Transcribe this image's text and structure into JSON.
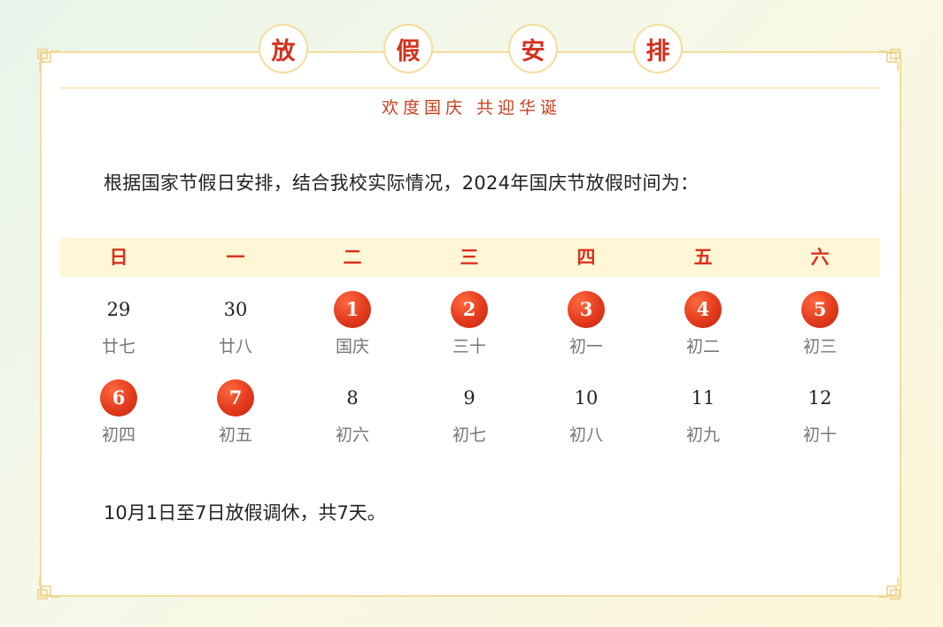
{
  "title_chars": [
    "放",
    "假",
    "安",
    "排"
  ],
  "subtitle": "欢度国庆  共迎华诞",
  "intro": "根据国家节假日安排，结合我校实际情况，2024年国庆节放假时间为：",
  "weekdays": [
    "日",
    "一",
    "二",
    "三",
    "四",
    "五",
    "六"
  ],
  "weeks": [
    [
      {
        "day": "29",
        "lunar": "廿七",
        "holiday": false
      },
      {
        "day": "30",
        "lunar": "廿八",
        "holiday": false
      },
      {
        "day": "1",
        "lunar": "国庆",
        "holiday": true
      },
      {
        "day": "2",
        "lunar": "三十",
        "holiday": true
      },
      {
        "day": "3",
        "lunar": "初一",
        "holiday": true
      },
      {
        "day": "4",
        "lunar": "初二",
        "holiday": true
      },
      {
        "day": "5",
        "lunar": "初三",
        "holiday": true
      }
    ],
    [
      {
        "day": "6",
        "lunar": "初四",
        "holiday": true
      },
      {
        "day": "7",
        "lunar": "初五",
        "holiday": true
      },
      {
        "day": "8",
        "lunar": "初六",
        "holiday": false
      },
      {
        "day": "9",
        "lunar": "初七",
        "holiday": false
      },
      {
        "day": "10",
        "lunar": "初八",
        "holiday": false
      },
      {
        "day": "11",
        "lunar": "初九",
        "holiday": false
      },
      {
        "day": "12",
        "lunar": "初十",
        "holiday": false
      }
    ]
  ],
  "footer": "10月1日至7日放假调休，共7天。",
  "colors": {
    "accent_red": "#d9311f",
    "frame_gold": "#f3dc9c",
    "weekbar_bg": "#fff7d6"
  }
}
